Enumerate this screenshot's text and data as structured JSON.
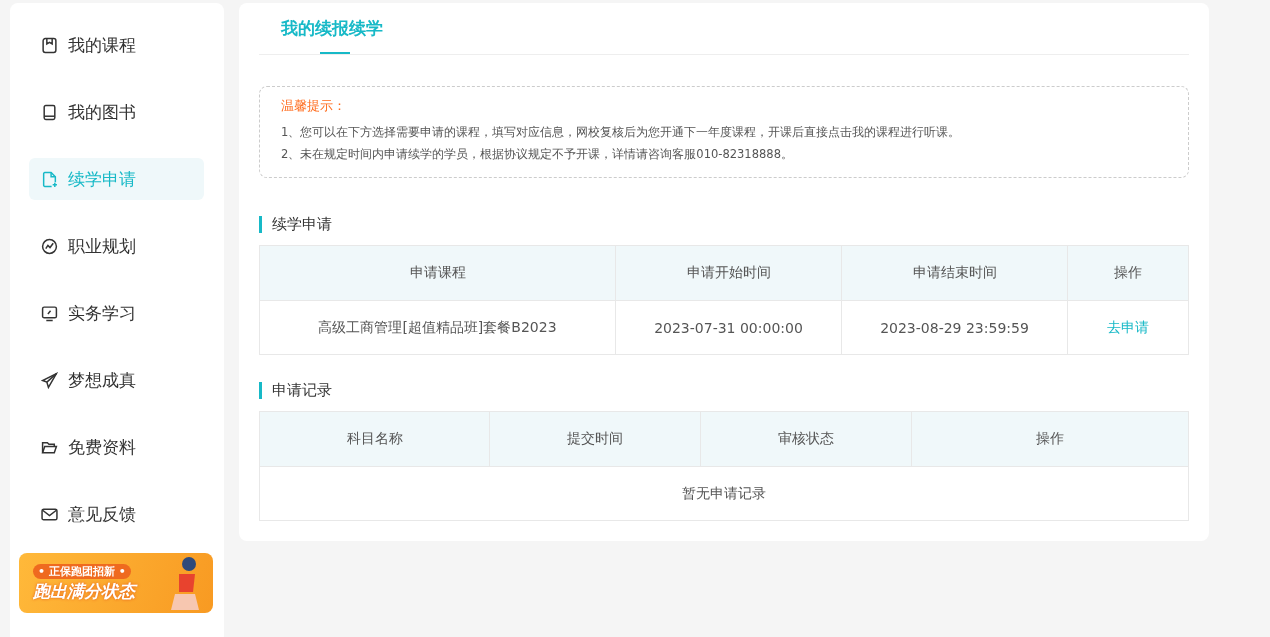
{
  "sidebar": {
    "items": [
      {
        "label": "我的课程",
        "selected": false
      },
      {
        "label": "我的图书",
        "selected": false
      },
      {
        "label": "续学申请",
        "selected": true
      },
      {
        "label": "职业规划",
        "selected": false
      },
      {
        "label": "实务学习",
        "selected": false
      },
      {
        "label": "梦想成真",
        "selected": false
      },
      {
        "label": "免费资料",
        "selected": false
      },
      {
        "label": "意见反馈",
        "selected": false
      }
    ],
    "banner": {
      "tagline": "• 正保跑团招新 •",
      "headline": "跑出满分状态"
    }
  },
  "tabs": [
    {
      "label": "我的续报续学",
      "selected": true
    }
  ],
  "notice": {
    "title": "温馨提示：",
    "lines": [
      "1、您可以在下方选择需要申请的课程，填写对应信息，网校复核后为您开通下一年度课程，开课后直接点击我的课程进行听课。",
      "2、未在规定时间内申请续学的学员，根据协议规定不予开课，详情请咨询客服010-82318888。"
    ]
  },
  "application": {
    "title": "续学申请",
    "columns": [
      "申请课程",
      "申请开始时间",
      "申请结束时间",
      "操作"
    ],
    "rows": [
      {
        "course": "高级工商管理[超值精品班]套餐B2023",
        "start": "2023-07-31 00:00:00",
        "end": "2023-08-29 23:59:59",
        "action": "去申请"
      }
    ]
  },
  "records": {
    "title": "申请记录",
    "columns": [
      "科目名称",
      "提交时间",
      "审核状态",
      "操作"
    ],
    "empty": "暂无申请记录"
  }
}
